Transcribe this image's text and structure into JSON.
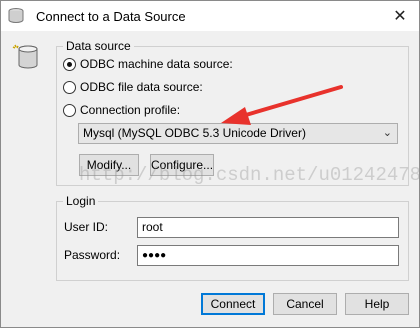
{
  "window": {
    "title": "Connect to a Data Source",
    "close_glyph": "✕"
  },
  "data_source": {
    "legend": "Data source",
    "options": [
      {
        "label": "ODBC machine data source:",
        "selected": true
      },
      {
        "label": "ODBC file data source:",
        "selected": false
      },
      {
        "label": "Connection profile:",
        "selected": false
      }
    ],
    "profile_select": {
      "value": "Mysql (MySQL ODBC 5.3 Unicode Driver)"
    },
    "modify_label": "Modify...",
    "configure_label": "Configure..."
  },
  "login": {
    "legend": "Login",
    "user_id_label": "User ID:",
    "user_id_value": "root",
    "password_label": "Password:",
    "password_value": "●●●●"
  },
  "buttons": {
    "connect": "Connect",
    "cancel": "Cancel",
    "help": "Help"
  },
  "watermark": "http://blog.csdn.net/u012424783",
  "colors": {
    "annotation_arrow": "#e8322c",
    "default_button_border": "#0078d7"
  },
  "icons": {
    "app": "database-icon",
    "close": "close-icon",
    "dropdown": "chevron-down-icon"
  }
}
